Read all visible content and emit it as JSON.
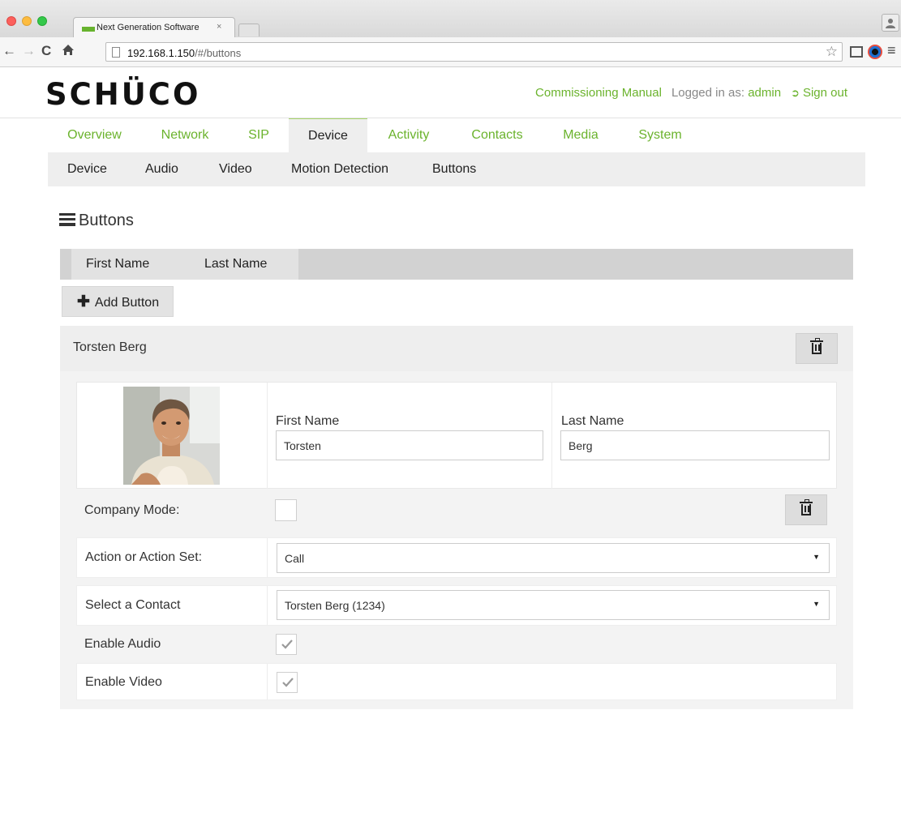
{
  "browser": {
    "tab_title": "Next Generation Software",
    "tab_close": "×",
    "url_host": "192.168.1.150",
    "url_path": "/#/buttons",
    "back_icon": "back-arrow-icon",
    "forward_icon": "forward-arrow-icon",
    "reload_icon": "reload-icon",
    "home_icon": "home-icon",
    "bookmark_icon": "star-icon",
    "cast_icon": "cast-icon",
    "menu_icon": "hamburger-menu-icon"
  },
  "header": {
    "logo_text": "SCHÜCO",
    "manual_link": "Commissioning Manual",
    "logged_in_label": "Logged in as:",
    "username": "admin",
    "signout_label": "Sign out"
  },
  "main_nav": {
    "items": [
      {
        "label": "Overview"
      },
      {
        "label": "Network"
      },
      {
        "label": "SIP"
      },
      {
        "label": "Device"
      },
      {
        "label": "Activity"
      },
      {
        "label": "Contacts"
      },
      {
        "label": "Media"
      },
      {
        "label": "System"
      }
    ],
    "active": "Device"
  },
  "sub_nav": {
    "items": [
      {
        "label": "Device"
      },
      {
        "label": "Audio"
      },
      {
        "label": "Video"
      },
      {
        "label": "Motion Detection"
      },
      {
        "label": "Buttons"
      }
    ],
    "active": "Buttons"
  },
  "section": {
    "title": "Buttons"
  },
  "table": {
    "columns": [
      "First Name",
      "Last Name"
    ]
  },
  "add_button": {
    "label": "Add Button"
  },
  "entry": {
    "name": "Torsten Berg",
    "first_name_label": "First Name",
    "first_name_value": "Torsten",
    "last_name_label": "Last Name",
    "last_name_value": "Berg",
    "company_mode_label": "Company Mode:",
    "company_mode_checked": false,
    "action_label": "Action or Action Set:",
    "action_value": "Call",
    "contact_label": "Select a Contact",
    "contact_value": "Torsten Berg (1234)",
    "enable_audio_label": "Enable Audio",
    "enable_audio_checked": true,
    "enable_video_label": "Enable Video",
    "enable_video_checked": true
  },
  "colors": {
    "accent_green": "#6bb32d",
    "nav_bg": "#eeeeee",
    "table_head_bg": "#d2d2d2"
  }
}
